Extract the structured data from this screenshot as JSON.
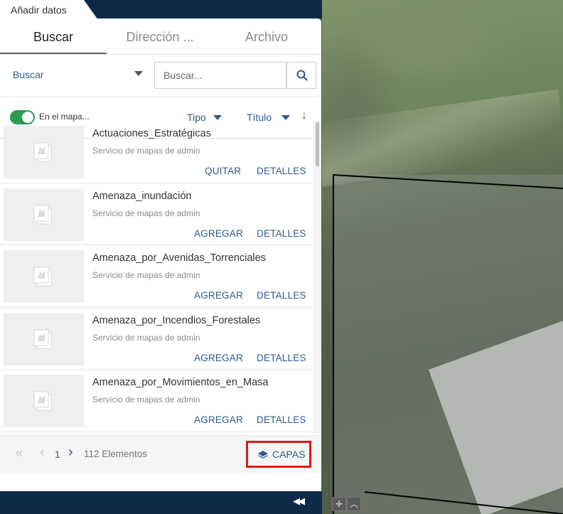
{
  "panel": {
    "title": "Añadir datos",
    "tabs": [
      {
        "label": "Buscar",
        "active": true
      },
      {
        "label": "Dirección ...",
        "active": false
      },
      {
        "label": "Archivo",
        "active": false
      }
    ],
    "search": {
      "scope": "Buscar",
      "placeholder": "Buscar..."
    },
    "filters": {
      "toggle_label": "En el mapa...",
      "toggle_on": true,
      "type_label": "Tipo",
      "title_sort_label": "Título",
      "sort_direction": "↓"
    },
    "items": [
      {
        "title": "Actuaciones_Estratégicas",
        "owner": "Servicio de mapas de admin",
        "action": "QUITAR",
        "details": "DETALLES"
      },
      {
        "title": "Amenaza_inundación",
        "owner": "Servicio de mapas de admin",
        "action": "AGREGAR",
        "details": "DETALLES"
      },
      {
        "title": "Amenaza_por_Avenidas_Torrenciales",
        "owner": "Servicio de mapas de admin",
        "action": "AGREGAR",
        "details": "DETALLES"
      },
      {
        "title": "Amenaza_por_Incendios_Forestales",
        "owner": "Servicio de mapas de admin",
        "action": "AGREGAR",
        "details": "DETALLES"
      },
      {
        "title": "Amenaza_por_Movimientos_en_Masa",
        "owner": "Servicio de mapas de admin",
        "action": "AGREGAR",
        "details": "DETALLES"
      }
    ],
    "footer": {
      "first_page": "«",
      "prev_page": "‹",
      "page": "1",
      "next_page": "›",
      "count": "112 Elementos",
      "layers_label": "CAPAS"
    },
    "collapse_icon": "double-chevron-left-icon"
  },
  "colors": {
    "accent": "#2c5b8e",
    "header": "#0f2a48",
    "toggle_on": "#2a9d52",
    "highlight": "#e01818"
  }
}
